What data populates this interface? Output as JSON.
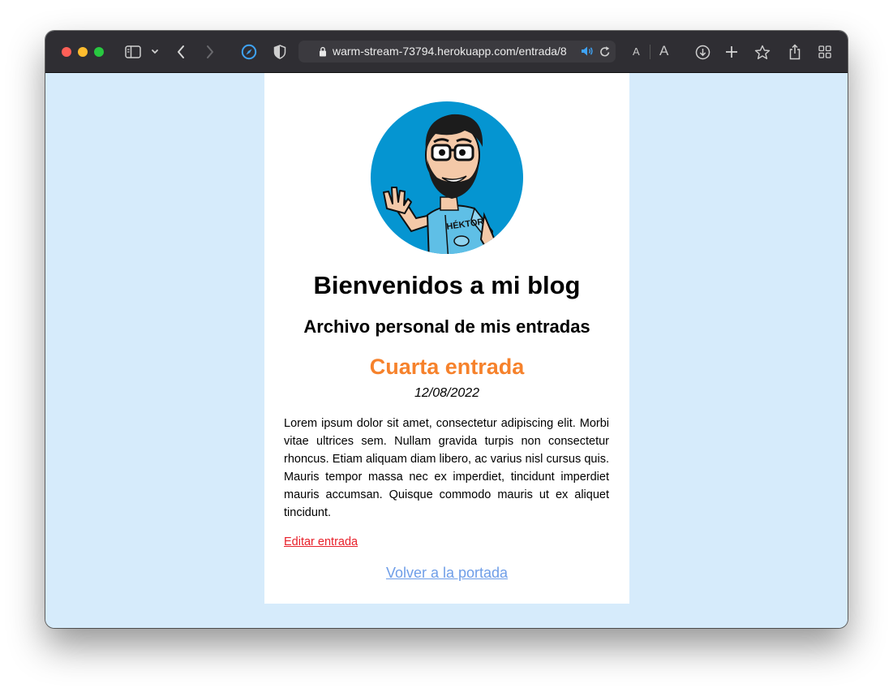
{
  "browser": {
    "url": "warm-stream-73794.herokuapp.com/entrada/8",
    "font_small_label": "A",
    "font_large_label": "A"
  },
  "blog": {
    "title": "Bienvenidos a mi blog",
    "subtitle": "Archivo personal de mis entradas",
    "avatar_caption": "HÉKTOR"
  },
  "post": {
    "title": "Cuarta entrada",
    "date": "12/08/2022",
    "body": "Lorem ipsum dolor sit amet, consectetur adipiscing elit. Morbi vitae ultrices sem. Nullam gravida turpis non consectetur rhoncus. Etiam aliquam diam libero, ac varius nisl cursus quis. Mauris tempor massa nec ex imperdiet, tincidunt imperdiet mauris accumsan. Quisque commodo mauris ut ex aliquet tincidunt.",
    "edit_label": "Editar entrada",
    "back_label": "Volver a la portada"
  },
  "colors": {
    "page_background": "#d6ebfb",
    "post_title": "#f6822c",
    "edit_link": "#e8202a",
    "back_link": "#6f9ee8",
    "avatar_circle": "#0595d1"
  },
  "icons": [
    "sidebar-icon",
    "chevron-down-icon",
    "back-icon",
    "forward-icon",
    "compass-icon",
    "shield-icon",
    "lock-icon",
    "speaker-icon",
    "reload-icon",
    "download-icon",
    "plus-icon",
    "star-icon",
    "share-icon",
    "tabs-grid-icon"
  ]
}
